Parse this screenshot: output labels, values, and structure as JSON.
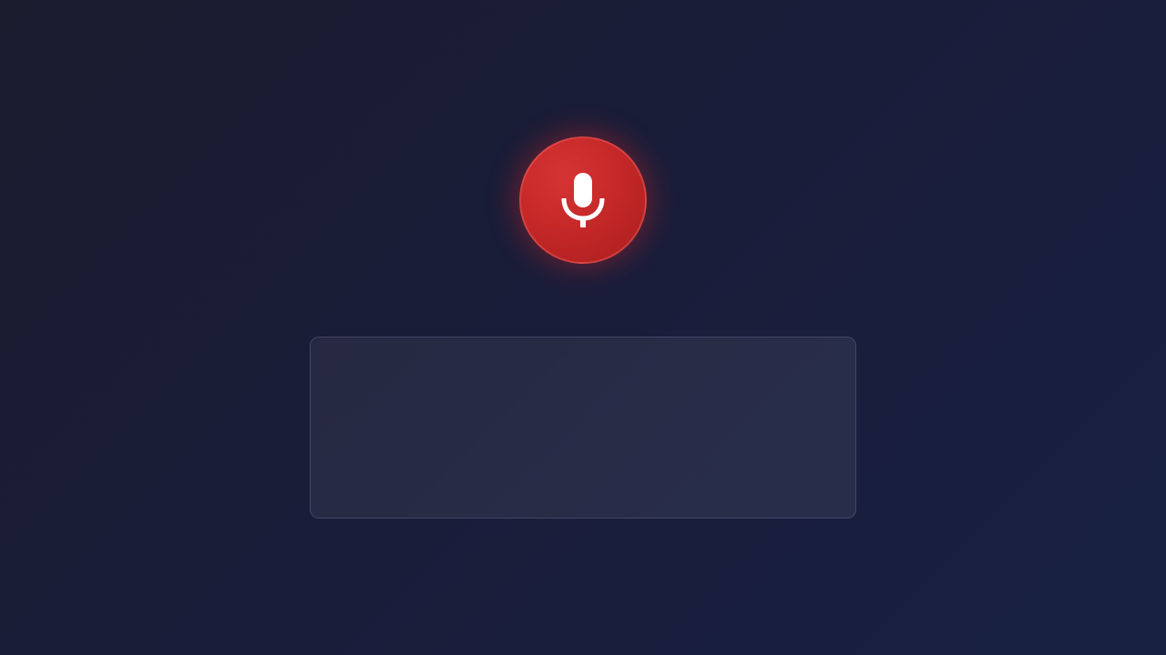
{
  "mic": {
    "state": "recording",
    "accent_color": "#c62828",
    "icon": "microphone-icon"
  },
  "transcript": {
    "text": ""
  }
}
